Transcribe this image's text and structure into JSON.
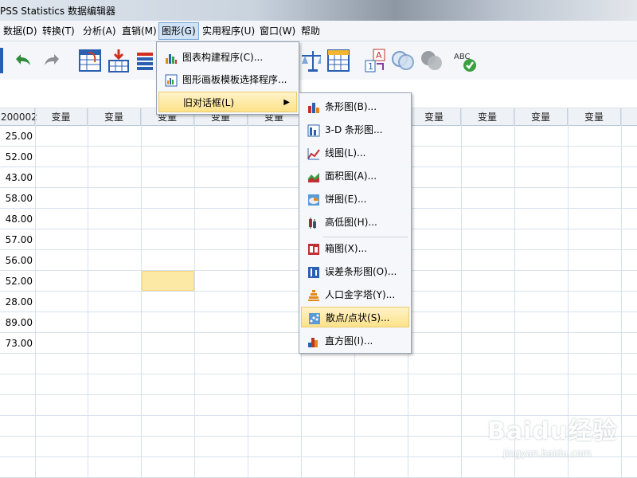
{
  "window": {
    "title": "PSS Statistics 数据编辑器"
  },
  "menubar": {
    "items": [
      {
        "label": "数据(D)"
      },
      {
        "label": "转换(T)"
      },
      {
        "label": "分析(A)"
      },
      {
        "label": "直销(M)"
      },
      {
        "label": "图形(G)"
      },
      {
        "label": "实用程序(U)"
      },
      {
        "label": "窗口(W)"
      },
      {
        "label": "帮助"
      }
    ]
  },
  "toolbar": {
    "icons": [
      "data-view-icon",
      "undo-icon",
      "redo-icon",
      "goto-case-icon",
      "insert-cases-icon",
      "insert-variable-icon",
      "weight-cases-icon",
      "value-labels-icon",
      "spelling-icon"
    ]
  },
  "grid": {
    "columns": [
      "200002",
      "变量",
      "变量",
      "变量",
      "变量",
      "变量",
      "变量",
      "变量",
      "变量",
      "变量",
      "变量",
      "变量"
    ],
    "values": [
      "25.00",
      "52.00",
      "43.00",
      "58.00",
      "48.00",
      "57.00",
      "56.00",
      "52.00",
      "28.00",
      "89.00",
      "73.00"
    ]
  },
  "graphs_menu": {
    "items": [
      {
        "label": "图表构建程序(C)...",
        "icon": "chart-builder-icon"
      },
      {
        "label": "图形画板模板选择程序...",
        "icon": "graphboard-template-icon"
      },
      {
        "label": "旧对话框(L)",
        "icon": "",
        "submenu": true
      }
    ]
  },
  "legacy_menu": {
    "items": [
      {
        "label": "条形图(B)...",
        "icon": "bar-chart-icon"
      },
      {
        "label": "3-D 条形图...",
        "icon": "3d-bar-chart-icon"
      },
      {
        "label": "线图(L)...",
        "icon": "line-chart-icon"
      },
      {
        "label": "面积图(A)...",
        "icon": "area-chart-icon"
      },
      {
        "label": "饼图(E)...",
        "icon": "pie-chart-icon"
      },
      {
        "label": "高低图(H)...",
        "icon": "high-low-chart-icon"
      },
      {
        "label": "箱图(X)...",
        "icon": "boxplot-icon"
      },
      {
        "label": "误差条形图(O)...",
        "icon": "error-bar-icon"
      },
      {
        "label": "人口金字塔(Y)...",
        "icon": "population-pyramid-icon"
      },
      {
        "label": "散点/点状(S)...",
        "icon": "scatter-dot-icon"
      },
      {
        "label": "直方图(I)...",
        "icon": "histogram-icon"
      }
    ]
  },
  "watermark": {
    "logo": "Baidu经验",
    "url": "jingyan.baidu.com"
  },
  "colors": {
    "highlight": "#fde28a",
    "selected_cell": "#fde9a6",
    "menu_active": "#cfe2f6"
  }
}
